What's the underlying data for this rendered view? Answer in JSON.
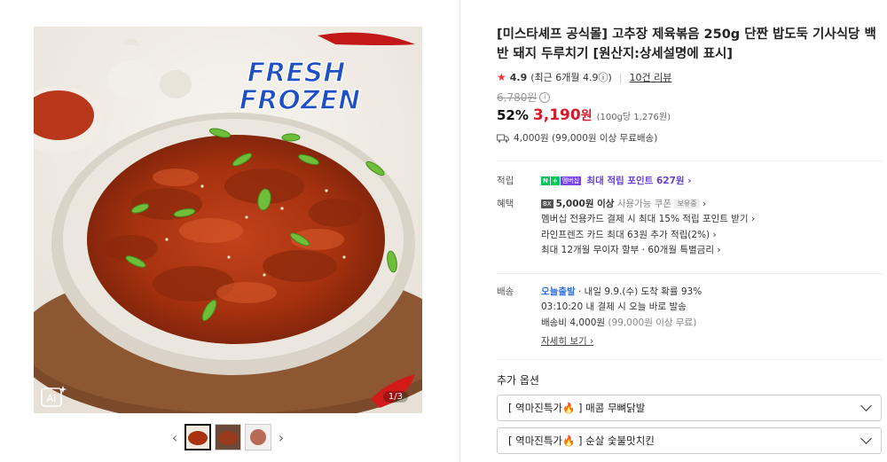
{
  "gallery": {
    "badge_fresh": "FRESH",
    "badge_frozen": "FROZEN",
    "page_indicator": "1/3",
    "ai_label": "AI",
    "prev_label": "‹",
    "next_label": "›"
  },
  "product": {
    "title": "[미스타셰프 공식몰] 고추장 제육볶음 250g 단짠 밥도둑 기사식당 백반 돼지 두루치기 [원산지:상세설명에 표시]",
    "rating": "4.9",
    "rating_sub": "(최근 6개월 4.9ⓘ)",
    "reviews": "10건 리뷰",
    "original_price": "6,780원",
    "discount": "52%",
    "price": "3,190",
    "price_unit_won": "원",
    "unit_price": "(100g당 1,276원)",
    "shipping": "4,000원 (99,000원 이상 무료배송)"
  },
  "points": {
    "label": "적립",
    "npay_n": "N",
    "npay_plus": "+",
    "npay_member": "멤버십",
    "text": "최대 적립 포인트 627원 ›"
  },
  "benefits": {
    "label": "혜택",
    "coupon_icon": "BX",
    "coupon_bold": "5,000원 이상",
    "coupon_text": "사용가능 쿠폰",
    "coupon_tag": "보유중",
    "coupon_arrow": "›",
    "line2": "멤버십 전용카드 결제 시 최대 15% 적립 포인트 받기 ›",
    "line3": "라인프렌즈 카드 최대 63원 추가 적립(2%) ›",
    "line4": "최대 12개월 무이자 할부 · 60개월 특별금리 ›"
  },
  "delivery": {
    "label": "배송",
    "today": "오늘출발",
    "eta": "· 내일 9.9.(수) 도착 확률 93%",
    "countdown": "03:10:20  내 결제 시 오늘 바로 발송",
    "fee": "배송비 4,000원",
    "fee_note": "(99,000원 이상 무료)",
    "details": "자세히 보기 ›"
  },
  "options": {
    "title": "추가 옵션",
    "items": [
      {
        "label": "[ 역마진특가🔥 ] 매콤 무뼈닭발"
      },
      {
        "label": "[ 역마진특가🔥 ] 순살 숯불맛치킨"
      }
    ]
  }
}
